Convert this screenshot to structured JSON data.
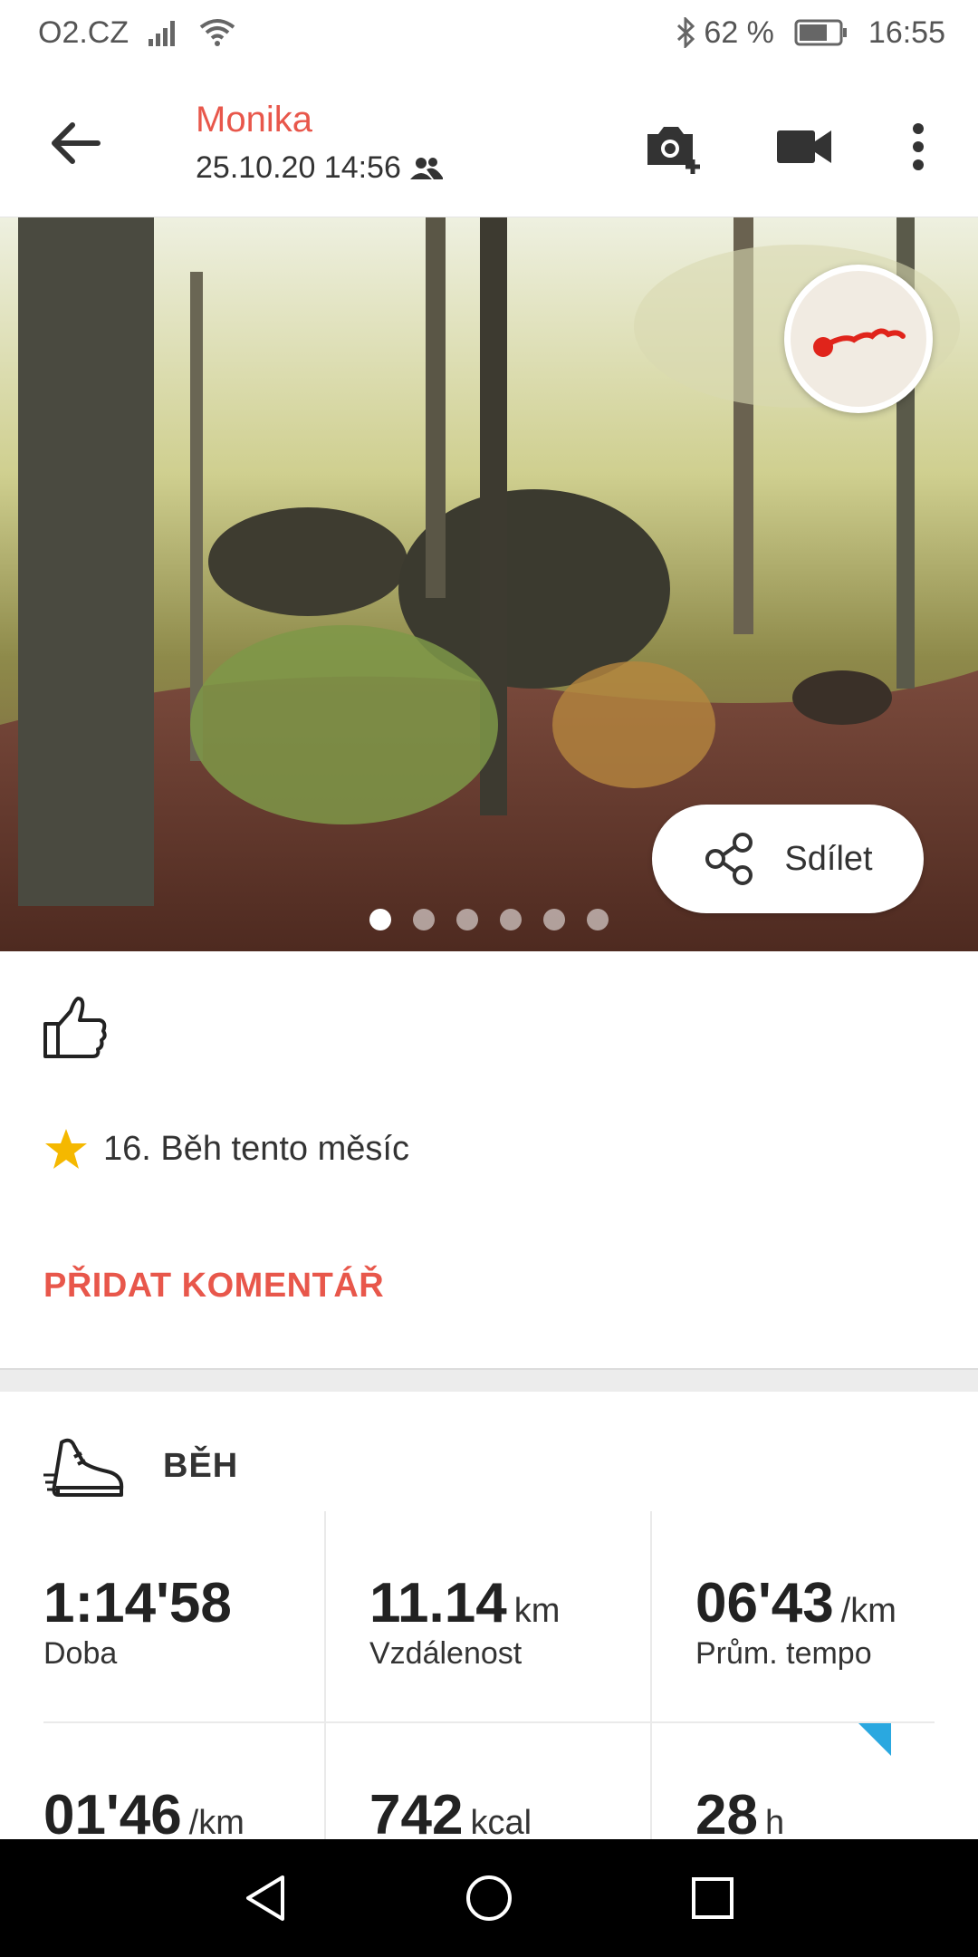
{
  "status_bar": {
    "carrier": "O2.CZ",
    "battery_percent": "62 %",
    "time": "16:55",
    "icons": [
      "signal-icon",
      "wifi-icon",
      "bluetooth-icon",
      "battery-icon"
    ]
  },
  "header": {
    "title": "Monika",
    "datetime": "25.10.20 14:56",
    "icons": [
      "back-arrow-icon",
      "people-icon",
      "add-photo-icon",
      "video-icon",
      "more-vert-icon"
    ]
  },
  "photo": {
    "share_label": "Sdílet",
    "page_count": 6,
    "active_page": 1
  },
  "social": {
    "achievement": "16. Běh tento měsíc",
    "add_comment": "PŘIDAT KOMENTÁŘ"
  },
  "activity": {
    "title": "BĚH",
    "stats": [
      {
        "value": "1:14'58",
        "unit": "",
        "label": "Doba"
      },
      {
        "value": "11.14",
        "unit": "km",
        "label": "Vzdálenost"
      },
      {
        "value": "06'43",
        "unit": "/km",
        "label": "Prům. tempo"
      },
      {
        "value": "01'46",
        "unit": "/km",
        "label": ""
      },
      {
        "value": "742",
        "unit": "kcal",
        "label": ""
      },
      {
        "value": "28",
        "unit": "h",
        "label": ""
      }
    ]
  },
  "colors": {
    "accent": "#e8574b",
    "star": "#f5b800",
    "corner_flag": "#2aa8e0"
  }
}
